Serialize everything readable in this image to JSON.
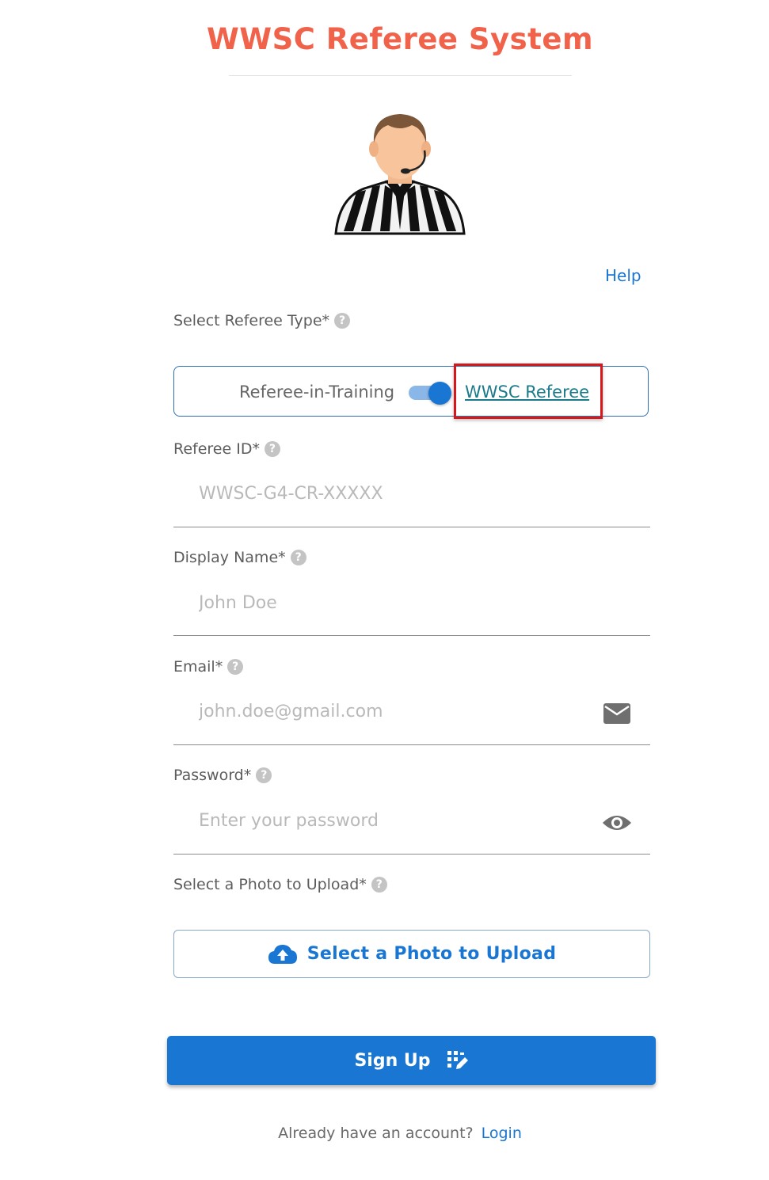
{
  "app": {
    "title": "WWSC Referee System"
  },
  "help_link": "Help",
  "referee_type": {
    "label": "Select Referee Type*",
    "option_left": "Referee-in-Training",
    "option_right": "WWSC Referee",
    "toggle_on": true,
    "highlight_color": "#d6171c"
  },
  "referee_id": {
    "label": "Referee ID*",
    "placeholder": "WWSC-G4-CR-XXXXX",
    "value": ""
  },
  "display_name": {
    "label": "Display Name*",
    "placeholder": "John Doe",
    "value": ""
  },
  "email": {
    "label": "Email*",
    "placeholder": "john.doe@gmail.com",
    "value": "",
    "icon": "mail-icon"
  },
  "password": {
    "label": "Password*",
    "placeholder": "Enter your password",
    "value": "",
    "icon": "eye-icon"
  },
  "photo": {
    "label": "Select a Photo to Upload*",
    "button_label": "Select a Photo to Upload",
    "icon": "cloud-upload-icon"
  },
  "signup": {
    "label": "Sign Up",
    "icon": "signup-icon"
  },
  "footer": {
    "question": "Already have an account?",
    "login_label": "Login"
  },
  "colors": {
    "title": "#f1624b",
    "primary": "#1976d2",
    "link_teal": "#1b7a8a"
  }
}
